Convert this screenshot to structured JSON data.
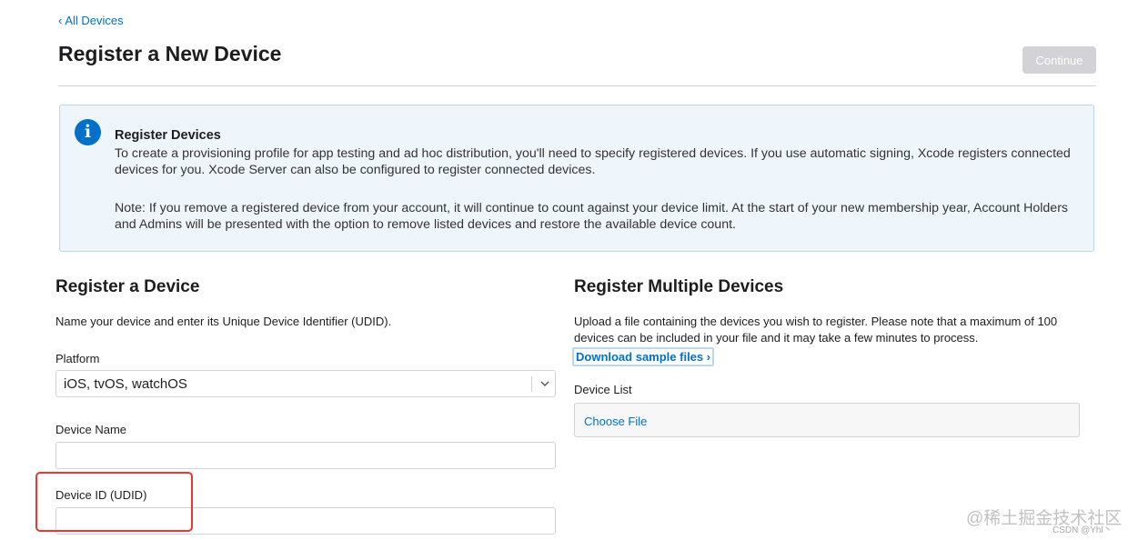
{
  "nav": {
    "back_chevron": "‹",
    "back_label": "All Devices"
  },
  "header": {
    "title": "Register a New Device",
    "continue_label": "Continue"
  },
  "info": {
    "icon": "info-icon",
    "icon_glyph": "i",
    "title": "Register Devices",
    "paragraph1": "To create a provisioning profile for app testing and ad hoc distribution, you'll need to specify registered devices. If you use automatic signing, Xcode registers connected devices for you. Xcode Server can also be configured to register connected devices.",
    "paragraph2": "Note: If you remove a registered device from your account, it will continue to count against your device limit. At the start of your new membership year, Account Holders and Admins will be presented with the option to remove listed devices and restore the available device count."
  },
  "register_device": {
    "title": "Register a Device",
    "description": "Name your device and enter its Unique Device Identifier (UDID).",
    "platform_label": "Platform",
    "platform_value": "iOS, tvOS, watchOS",
    "device_name_label": "Device Name",
    "device_name_value": "",
    "device_id_label": "Device ID (UDID)",
    "device_id_value": ""
  },
  "register_multiple": {
    "title": "Register Multiple Devices",
    "description": "Upload a file containing the devices you wish to register. Please note that a maximum of 100 devices can be included in your file and it may take a few minutes to process.",
    "download_label": "Download sample files ›",
    "device_list_label": "Device List",
    "choose_file_label": "Choose File"
  },
  "watermark": {
    "main": "@稀土掘金技术社区",
    "small": "CSDN @Yhl丶"
  },
  "colors": {
    "accent": "#0070c9",
    "info_bg": "#eef6fb",
    "highlight": "#e8382f",
    "disabled": "#d2d2d7"
  }
}
